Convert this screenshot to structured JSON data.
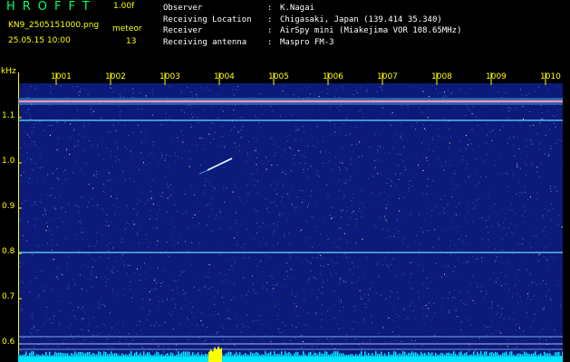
{
  "header": {
    "title": "HROFFT",
    "version": "1.00f",
    "filename": "KN9_2505151000.png",
    "timestamp": "25.05.15 10:00",
    "meteor_label": "meteor",
    "meteor_count": "13"
  },
  "info": [
    {
      "label": "Observer",
      "sep": ":",
      "value": "K.Nagai"
    },
    {
      "label": "Receiving Location",
      "sep": ":",
      "value": "Chigasaki, Japan (139.414 35.340)"
    },
    {
      "label": "Receiver",
      "sep": ":",
      "value": "AirSpy mini (Miakejima VOR 108.65MHz)"
    },
    {
      "label": "Receiving antenna",
      "sep": ":",
      "value": "Maspro FM-3"
    }
  ],
  "axis": {
    "y_unit": "kHz",
    "y_ticks": [
      "1.1",
      "1.0",
      "0.9",
      "0.8",
      "0.7",
      "0.6"
    ],
    "x_ticks": [
      "1001",
      "1002",
      "1003",
      "1004",
      "1005",
      "1006",
      "1007",
      "1008",
      "1009",
      "1010"
    ]
  },
  "colors": {
    "background": "#000000",
    "plot_bg": "#0c1a7a",
    "accent_yellow": "#ffff00",
    "accent_green": "#00ff66",
    "noise_strip": "#00e5ff",
    "carrier_line": "#ff6fa6"
  }
}
